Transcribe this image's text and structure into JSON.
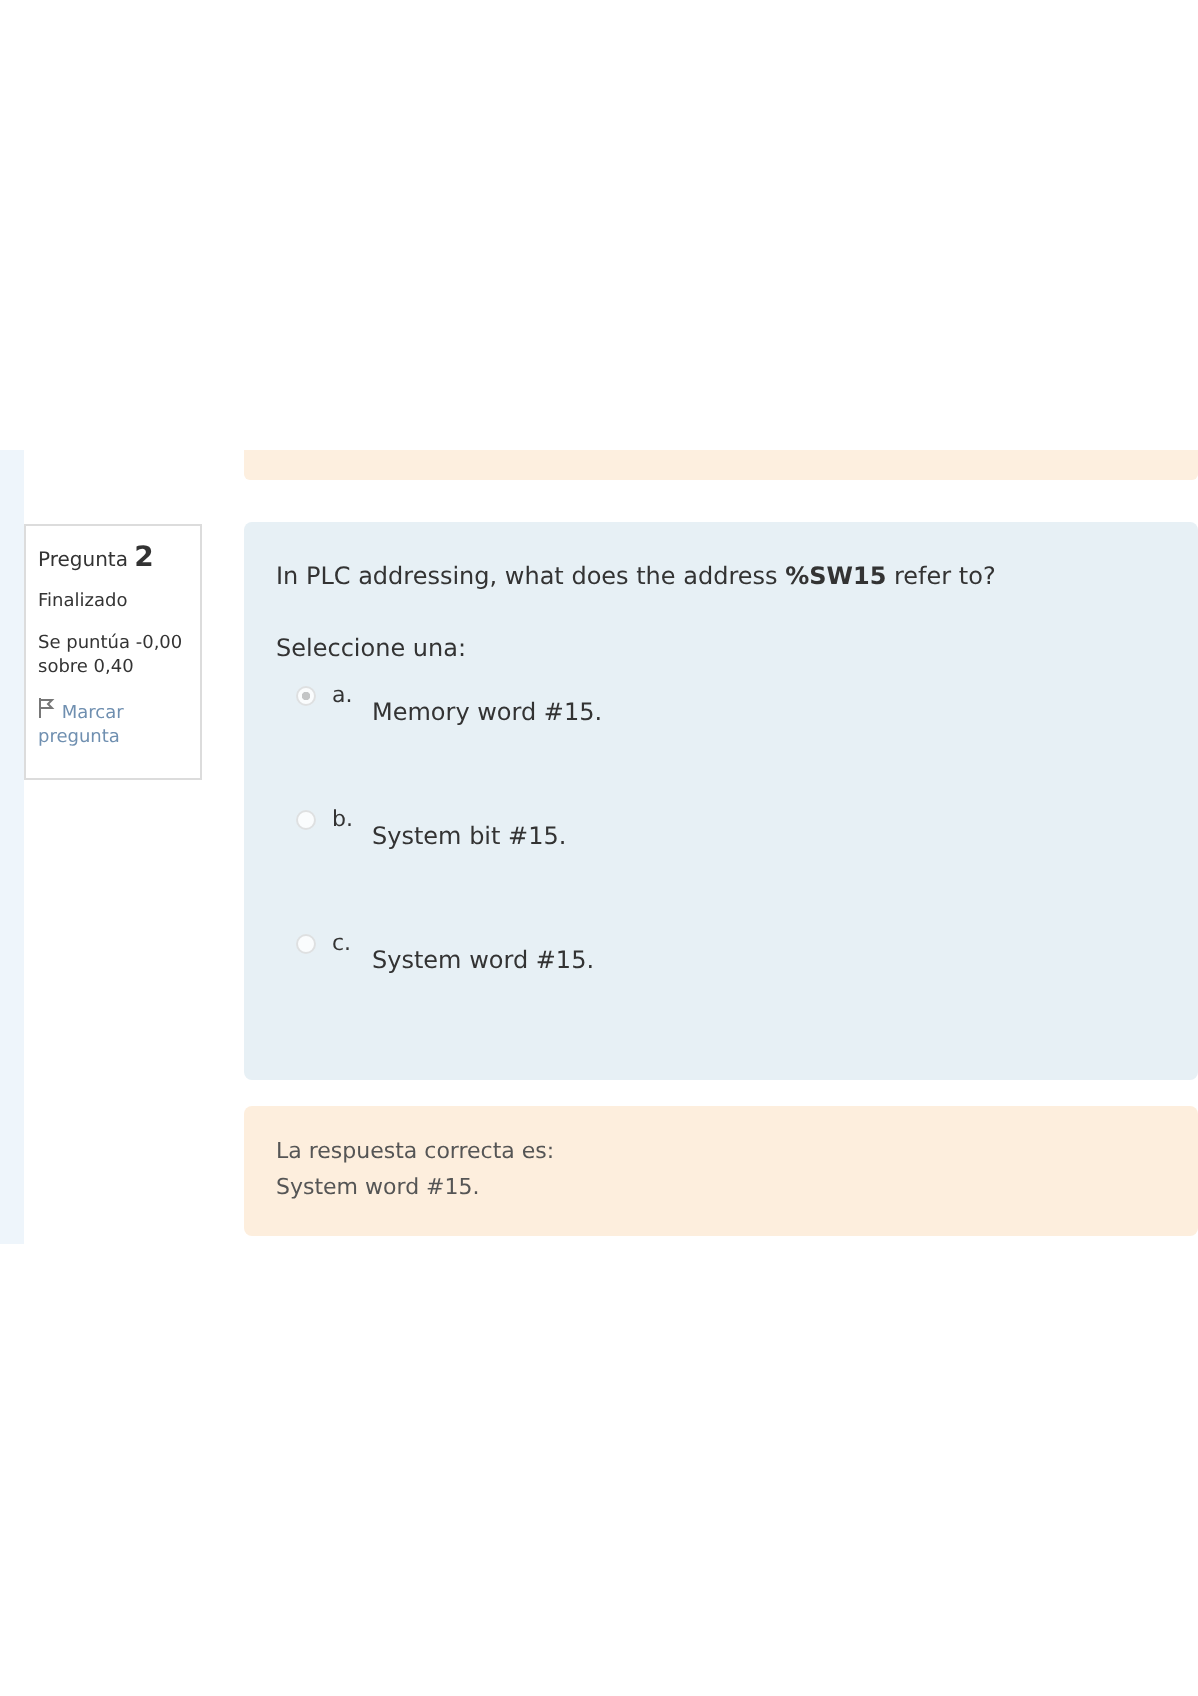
{
  "question": {
    "label": "Pregunta",
    "number": "2",
    "status": "Finalizado",
    "score": "Se puntúa -0,00 sobre 0,40",
    "flag": "Marcar pregunta"
  },
  "text": "In PLC addressing, what does the address **%SW15** refer to?",
  "prompt": "Seleccione una:",
  "options": [
    {
      "letter": "a.",
      "text": "Memory word #15.",
      "selected": true,
      "disabled": true
    },
    {
      "letter": "b.",
      "text": "System bit #15.",
      "selected": false,
      "disabled": true
    },
    {
      "letter": "c.",
      "text": "System word #15.",
      "selected": false,
      "disabled": true
    }
  ],
  "feedback": {
    "heading": "La respuesta correcta es:",
    "answer": "System word #15."
  }
}
